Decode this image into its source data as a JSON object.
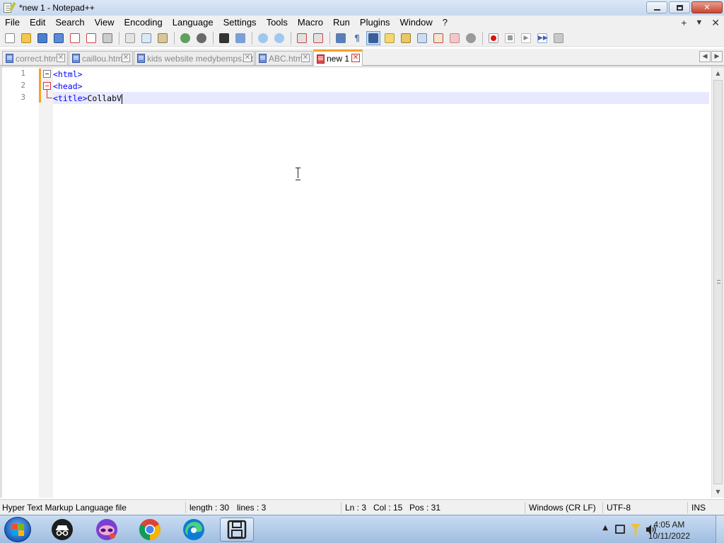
{
  "window": {
    "title": "*new 1 - Notepad++"
  },
  "menu": {
    "items": [
      "File",
      "Edit",
      "Search",
      "View",
      "Encoding",
      "Language",
      "Settings",
      "Tools",
      "Macro",
      "Run",
      "Plugins",
      "Window",
      "?"
    ],
    "right": {
      "plus": "+",
      "dropdown": "▼",
      "close": "✕"
    }
  },
  "tabs": [
    {
      "label": "correct.html",
      "active": false
    },
    {
      "label": "caillou.html",
      "active": false
    },
    {
      "label": "kids website medybemps.txt",
      "active": false
    },
    {
      "label": "ABC.html",
      "active": false
    },
    {
      "label": "new 1",
      "active": true
    }
  ],
  "editor": {
    "line_numbers": [
      "1",
      "2",
      "3"
    ],
    "lines": [
      {
        "tag": "<html>",
        "text": ""
      },
      {
        "tag": "<head>",
        "text": ""
      },
      {
        "tag": "<title>",
        "text": "CollabV"
      }
    ]
  },
  "status": {
    "file_type": "Hyper Text Markup Language file",
    "length": "length : 30",
    "lines": "lines : 3",
    "ln": "Ln : 3",
    "col": "Col : 15",
    "pos": "Pos : 31",
    "eol": "Windows (CR LF)",
    "encoding": "UTF-8",
    "mode": "INS"
  },
  "taskbar": {
    "apps": [
      "incognito-app",
      "mask-app",
      "chrome",
      "edge",
      "notepadpp-save"
    ],
    "time": "4:05 AM",
    "date": "10/11/2022"
  }
}
